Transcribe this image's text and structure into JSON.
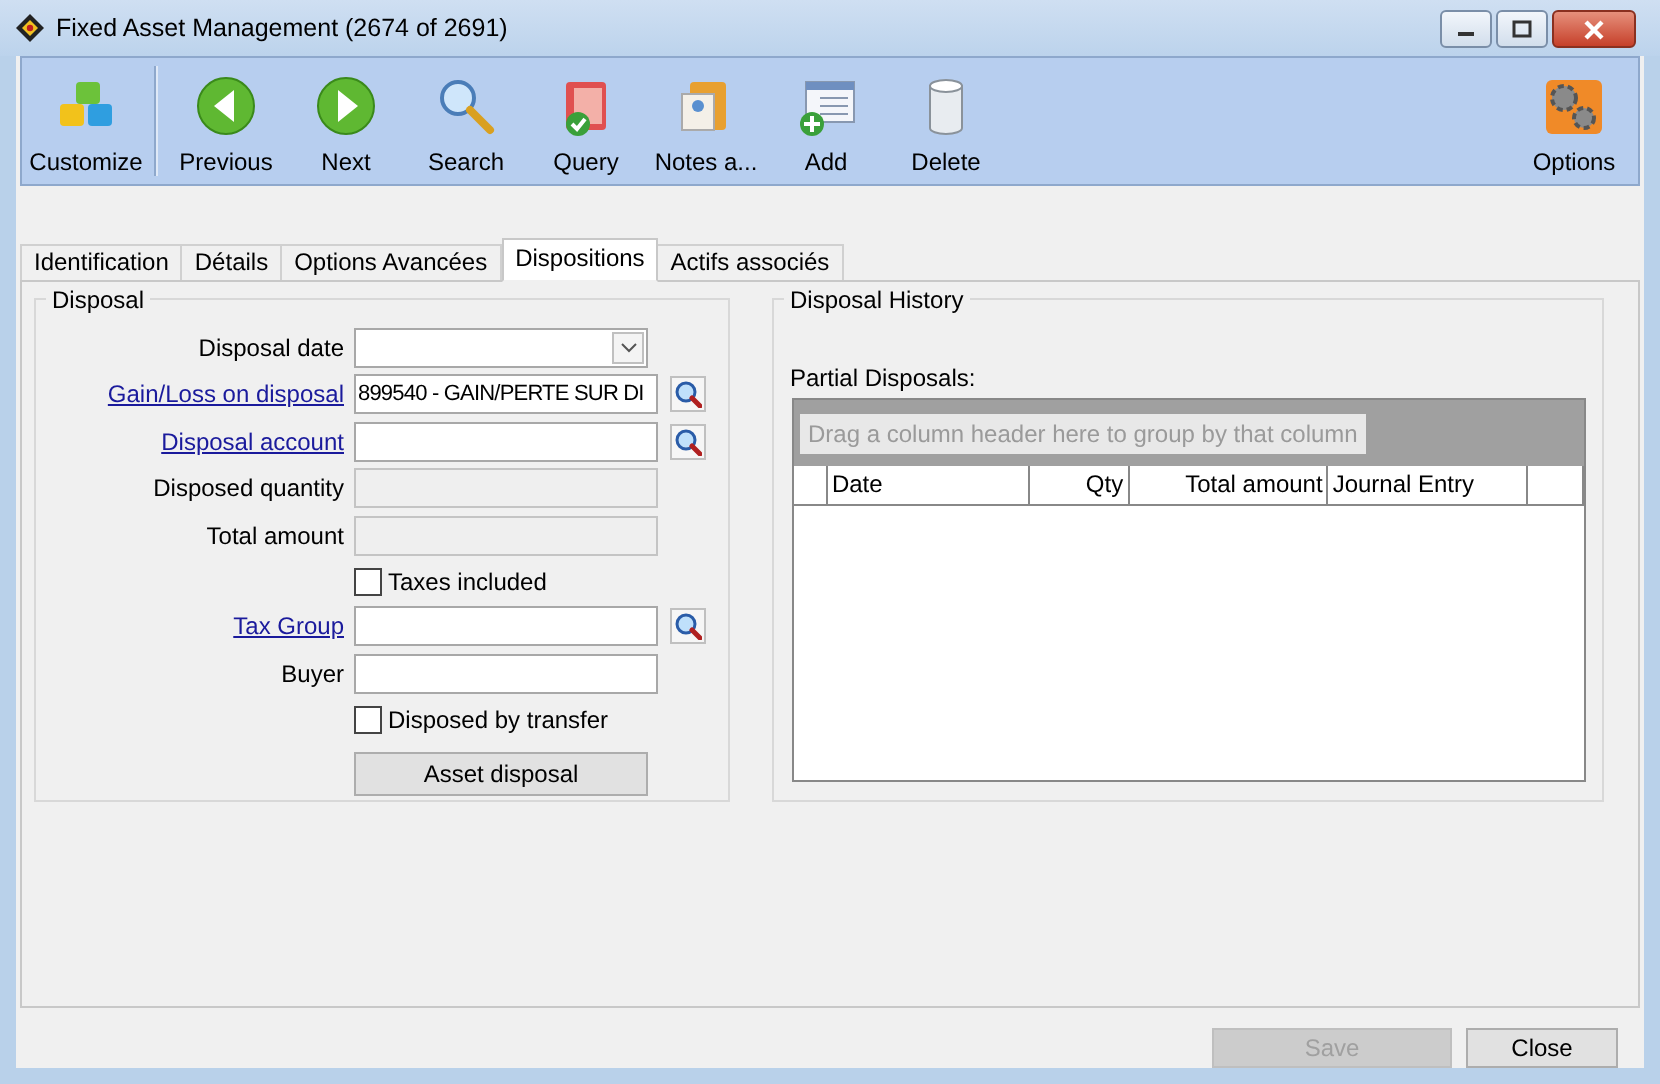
{
  "window": {
    "title": "Fixed Asset Management (2674 of 2691)"
  },
  "toolbar": {
    "items": [
      {
        "label": "Customize"
      },
      {
        "label": "Previous"
      },
      {
        "label": "Next"
      },
      {
        "label": "Search"
      },
      {
        "label": "Query"
      },
      {
        "label": "Notes a..."
      },
      {
        "label": "Add"
      },
      {
        "label": "Delete"
      }
    ],
    "right_items": [
      {
        "label": "Options"
      }
    ]
  },
  "tabs": [
    {
      "label": "Identification",
      "selected": false
    },
    {
      "label": "Détails",
      "selected": false
    },
    {
      "label": "Options Avancées",
      "selected": false
    },
    {
      "label": "Dispositions",
      "selected": true
    },
    {
      "label": "Actifs associés",
      "selected": false
    }
  ],
  "disposal": {
    "title": "Disposal",
    "items": [
      {
        "kind": "date",
        "label": "Disposal date",
        "link": false
      },
      {
        "kind": "lookup",
        "label": "Gain/Loss on disposal",
        "link": true,
        "value": "899540 - GAIN/PERTE SUR DI"
      },
      {
        "kind": "lookup",
        "label": "Disposal account",
        "link": true
      },
      {
        "kind": "text",
        "label": "Disposed quantity",
        "link": false,
        "disabled": true
      },
      {
        "kind": "text",
        "label": "Total amount",
        "link": false,
        "disabled": true
      },
      {
        "kind": "checkbox",
        "label": "Taxes included",
        "checked": false
      },
      {
        "kind": "lookup",
        "label": "Tax Group",
        "link": true
      },
      {
        "kind": "text",
        "label": "Buyer",
        "link": false,
        "disabled": false
      },
      {
        "kind": "checkbox",
        "label": "Disposed by transfer",
        "checked": false
      },
      {
        "kind": "button",
        "label": "Asset disposal"
      }
    ]
  },
  "disposal_history": {
    "title": "Disposal History",
    "grid_label": "Partial Disposals:",
    "group_hint": "Drag a column header here to group by that column",
    "columns": [
      {
        "label": "Date"
      },
      {
        "label": "Qty"
      },
      {
        "label": "Total amount"
      },
      {
        "label": "Journal Entry"
      }
    ]
  },
  "buttons": [
    {
      "label": "Save",
      "disabled": true
    },
    {
      "label": "Close",
      "disabled": false
    }
  ]
}
